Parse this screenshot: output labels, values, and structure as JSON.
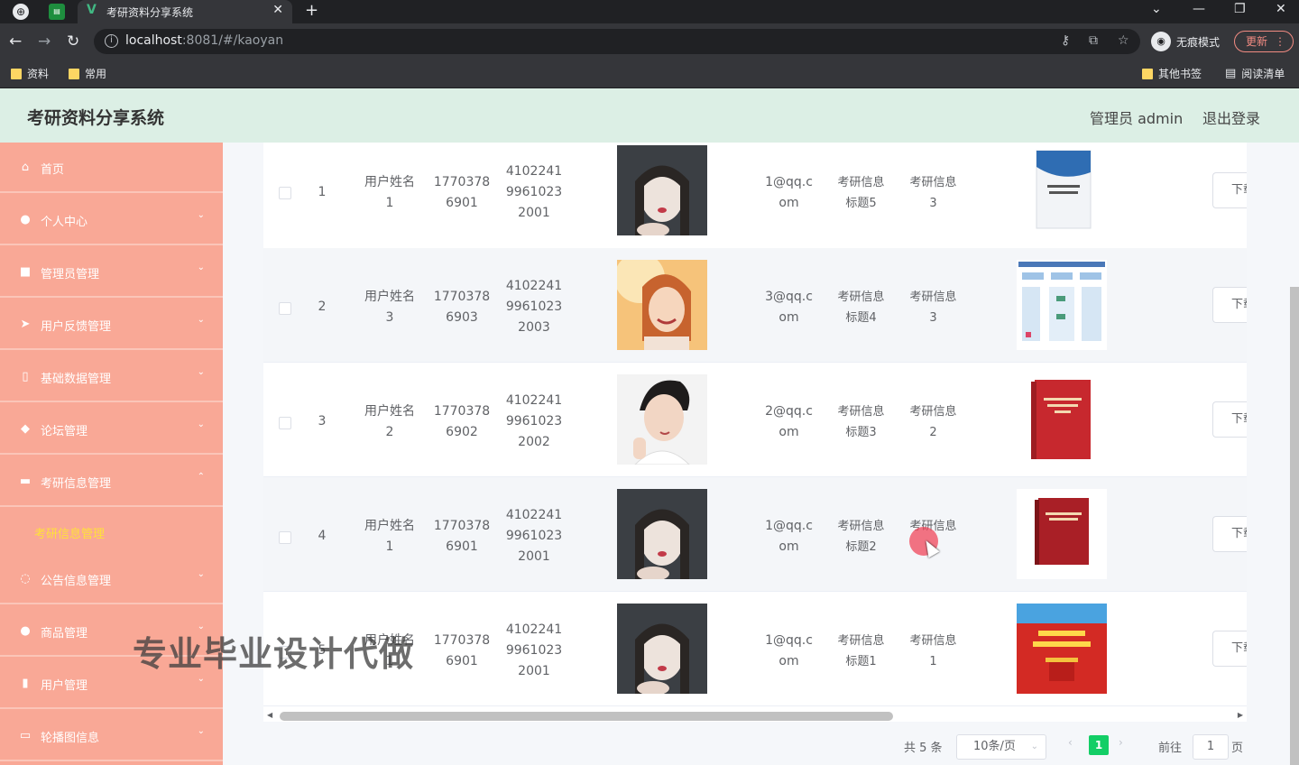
{
  "browser": {
    "tab_title": "考研资料分享系统",
    "tab_close": "✕",
    "new_tab": "+",
    "url_host": "localhost",
    "url_rest": ":8081/#/kaoyan",
    "incognito_label": "无痕模式",
    "update_label": "更新",
    "bookmarks": [
      "资料",
      "常用"
    ],
    "bookmarks_right": [
      "其他书签",
      "阅读清单"
    ]
  },
  "header": {
    "title": "考研资料分享系统",
    "admin_label": "管理员 admin",
    "logout_label": "退出登录"
  },
  "sidebar": {
    "items": [
      {
        "label": "首页",
        "icon": "home-icon",
        "glyph": "⌂",
        "arrow": ""
      },
      {
        "label": "个人中心",
        "icon": "user-icon",
        "glyph": "●",
        "arrow": "⌄"
      },
      {
        "label": "管理员管理",
        "icon": "briefcase-icon",
        "glyph": "■",
        "arrow": "⌄"
      },
      {
        "label": "用户反馈管理",
        "icon": "send-icon",
        "glyph": "➤",
        "arrow": "⌄"
      },
      {
        "label": "基础数据管理",
        "icon": "phone-icon",
        "glyph": "▯",
        "arrow": "⌄"
      },
      {
        "label": "论坛管理",
        "icon": "shield-icon",
        "glyph": "◆",
        "arrow": "⌄"
      },
      {
        "label": "考研信息管理",
        "icon": "chat-icon",
        "glyph": "▬",
        "arrow": "⌃"
      },
      {
        "label": "公告信息管理",
        "icon": "power-icon",
        "glyph": "◌",
        "arrow": "⌄"
      },
      {
        "label": "商品管理",
        "icon": "person-icon",
        "glyph": "●",
        "arrow": "⌄"
      },
      {
        "label": "用户管理",
        "icon": "chart-icon",
        "glyph": "▮",
        "arrow": "⌄"
      },
      {
        "label": "轮播图信息",
        "icon": "message-icon",
        "glyph": "▭",
        "arrow": "⌄"
      }
    ],
    "active_sub": "考研信息管理"
  },
  "table": {
    "rows": [
      {
        "index": "1",
        "name": [
          "用户姓名",
          "1"
        ],
        "phone": [
          "1770378",
          "6901"
        ],
        "id": [
          "4102241",
          "9961023",
          "2001"
        ],
        "email": [
          "1@qq.c",
          "om"
        ],
        "title": [
          "考研信息",
          "标题5"
        ],
        "info": [
          "考研信息",
          "3"
        ],
        "button": "下载"
      },
      {
        "index": "2",
        "name": [
          "用户姓名",
          "3"
        ],
        "phone": [
          "1770378",
          "6903"
        ],
        "id": [
          "4102241",
          "9961023",
          "2003"
        ],
        "email": [
          "3@qq.c",
          "om"
        ],
        "title": [
          "考研信息",
          "标题4"
        ],
        "info": [
          "考研信息",
          "3"
        ],
        "button": "下载"
      },
      {
        "index": "3",
        "name": [
          "用户姓名",
          "2"
        ],
        "phone": [
          "1770378",
          "6902"
        ],
        "id": [
          "4102241",
          "9961023",
          "2002"
        ],
        "email": [
          "2@qq.c",
          "om"
        ],
        "title": [
          "考研信息",
          "标题3"
        ],
        "info": [
          "考研信息",
          "2"
        ],
        "button": "下载"
      },
      {
        "index": "4",
        "name": [
          "用户姓名",
          "1"
        ],
        "phone": [
          "1770378",
          "6901"
        ],
        "id": [
          "4102241",
          "9961023",
          "2001"
        ],
        "email": [
          "1@qq.c",
          "om"
        ],
        "title": [
          "考研信息",
          "标题2"
        ],
        "info": [
          "考研信息",
          ""
        ],
        "button": "下载"
      },
      {
        "index": "5",
        "name": [
          "用户姓名",
          "1"
        ],
        "phone": [
          "1770378",
          "6901"
        ],
        "id": [
          "4102241",
          "9961023",
          "2001"
        ],
        "email": [
          "1@qq.c",
          "om"
        ],
        "title": [
          "考研信息",
          "标题1"
        ],
        "info": [
          "考研信息",
          "1"
        ],
        "button": "下载"
      }
    ]
  },
  "pager": {
    "total": "共 5 条",
    "page_size": "10条/页",
    "current": "1",
    "goto_label": "前往",
    "goto_value": "1",
    "page_label": "页"
  },
  "watermark": "专业毕业设计代做"
}
